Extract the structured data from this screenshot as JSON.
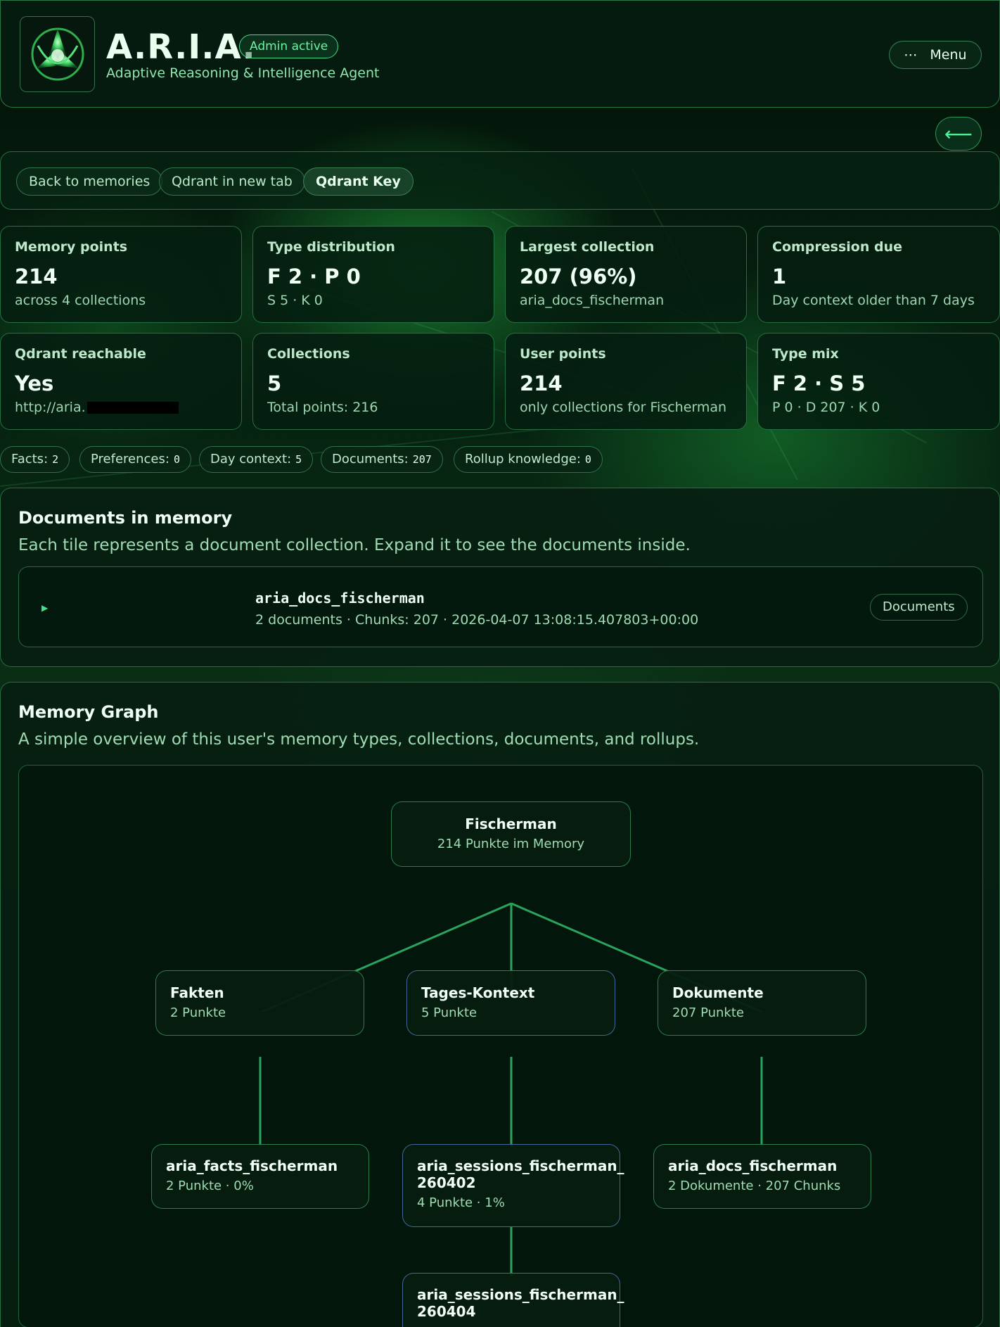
{
  "header": {
    "title": "A.R.I.A.",
    "admin_badge": "Admin active",
    "subtitle": "Adaptive Reasoning & Intelligence Agent",
    "menu_icon": "⋯",
    "menu_label": "Menu",
    "back_icon": "⟵"
  },
  "toolbar": {
    "back_to_memories": "Back to memories",
    "qdrant_new_tab": "Qdrant in new tab",
    "qdrant_key": "Qdrant Key"
  },
  "stats": [
    {
      "label": "Memory points",
      "value": "214",
      "sub": "across 4 collections"
    },
    {
      "label": "Type distribution",
      "value": "F 2 · P 0",
      "sub": "S 5 · K 0"
    },
    {
      "label": "Largest collection",
      "value": "207 (96%)",
      "sub": "aria_docs_fischerman"
    },
    {
      "label": "Compression due",
      "value": "1",
      "sub": "Day context older than 7 days"
    },
    {
      "label": "Qdrant reachable",
      "value": "Yes",
      "sub": "http://aria."
    },
    {
      "label": "Collections",
      "value": "5",
      "sub": "Total points: 216"
    },
    {
      "label": "User points",
      "value": "214",
      "sub": "only collections for Fischerman"
    },
    {
      "label": "Type mix",
      "value": "F 2 · S 5",
      "sub": "P 0 · D 207 · K 0"
    }
  ],
  "chips": [
    {
      "label": "Facts:",
      "value": "2"
    },
    {
      "label": "Preferences:",
      "value": "0"
    },
    {
      "label": "Day context:",
      "value": "5"
    },
    {
      "label": "Documents:",
      "value": "207"
    },
    {
      "label": "Rollup knowledge:",
      "value": "0"
    }
  ],
  "documents_panel": {
    "title": "Documents in memory",
    "description": "Each tile represents a document collection. Expand it to see the documents inside.",
    "collection": {
      "name": "aria_docs_fischerman",
      "meta": "2 documents · Chunks: 207 · 2026-04-07 13:08:15.407803+00:00",
      "badge": "Documents"
    }
  },
  "graph_panel": {
    "title": "Memory Graph",
    "description": "A simple overview of this user's memory types, collections, documents, and rollups.",
    "root": {
      "title": "Fischerman",
      "sub": "214 Punkte im Memory"
    },
    "types": [
      {
        "title": "Fakten",
        "sub": "2 Punkte"
      },
      {
        "title": "Tages-Kontext",
        "sub": "5 Punkte"
      },
      {
        "title": "Dokumente",
        "sub": "207 Punkte"
      }
    ],
    "collections": [
      {
        "title": "aria_facts_fischerman",
        "sub": "2 Punkte · 0%"
      },
      {
        "title": "aria_sessions_fischerman_ 260402",
        "sub": "4 Punkte · 1%"
      },
      {
        "title": "aria_docs_fischerman",
        "sub": "2 Dokumente · 207 Chunks"
      },
      {
        "title": "aria_sessions_fischerman_ 260404",
        "sub": ""
      }
    ]
  }
}
